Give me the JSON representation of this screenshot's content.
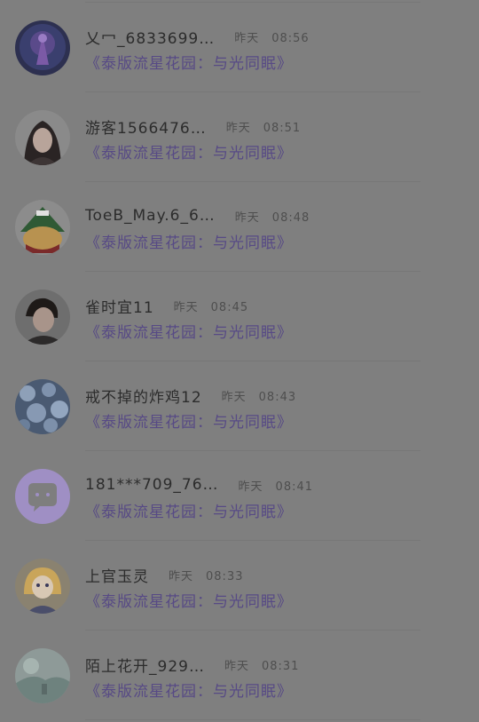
{
  "comments": [
    {
      "name": "乂冖_6833699…",
      "day": "昨天",
      "time": "08:56",
      "title": "《泰版流星花园：与光同眠》",
      "avatar": "avatar-purple-figure"
    },
    {
      "name": "游客1566476…",
      "day": "昨天",
      "time": "08:51",
      "title": "《泰版流星花园：与光同眠》",
      "avatar": "avatar-girl-portrait"
    },
    {
      "name": "ToeB_May.6_6…",
      "day": "昨天",
      "time": "08:48",
      "title": "《泰版流星花园：与光同眠》",
      "avatar": "avatar-cartoon-bear"
    },
    {
      "name": "雀时宜11",
      "day": "昨天",
      "time": "08:45",
      "title": "《泰版流星花园：与光同眠》",
      "avatar": "avatar-boy-portrait"
    },
    {
      "name": "戒不掉的炸鸡12",
      "day": "昨天",
      "time": "08:43",
      "title": "《泰版流星花园：与光同眠》",
      "avatar": "avatar-blue-texture"
    },
    {
      "name": "181***709_76…",
      "day": "昨天",
      "time": "08:41",
      "title": "《泰版流星花园：与光同眠》",
      "avatar": "avatar-default-chat"
    },
    {
      "name": "上官玉灵",
      "day": "昨天",
      "time": "08:33",
      "title": "《泰版流星花园：与光同眠》",
      "avatar": "avatar-anime-girl"
    },
    {
      "name": "陌上花开_929…",
      "day": "昨天",
      "time": "08:31",
      "title": "《泰版流星花园：与光同眠》",
      "avatar": "avatar-scenery"
    }
  ],
  "colors": {
    "background": "#7f7f7f",
    "name": "#2c2c2c",
    "time": "#4e4e4e",
    "title": "#574a85",
    "default_avatar": "#9f8fc4"
  }
}
